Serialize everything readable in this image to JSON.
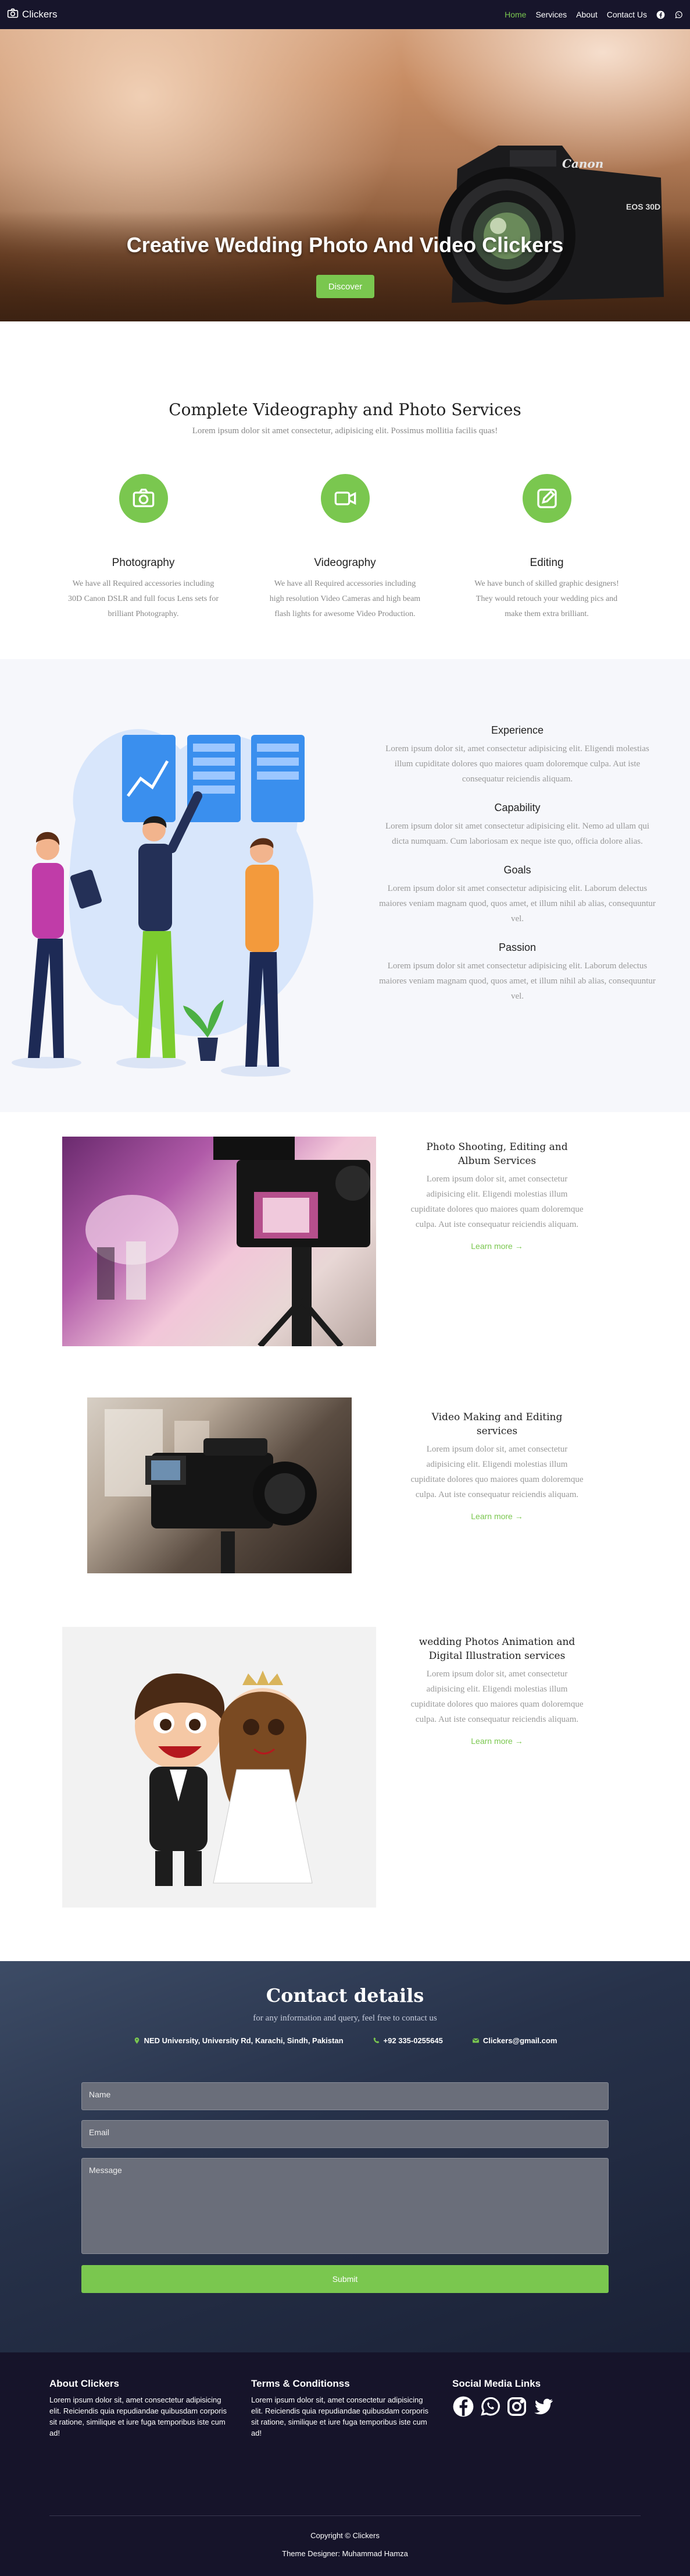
{
  "nav": {
    "brand": "Clickers",
    "links": [
      "Home",
      "Services",
      "About",
      "Contact Us"
    ],
    "accent": "#7ac74f",
    "background": "#17152b",
    "icons": [
      "camera-icon",
      "facebook-icon",
      "whatsapp-icon"
    ]
  },
  "hero": {
    "title": "Creative Wedding Photo And Video Clickers",
    "button": "Discover",
    "camera_brand": "Canon",
    "camera_model": "EOS 30D"
  },
  "services": {
    "title": "Complete Videography and Photo Services",
    "subtitle": "Lorem ipsum dolor sit amet consectetur, adipisicing elit. Possimus mollitia facilis quas!",
    "items": [
      {
        "title": "Photography",
        "text": "We have all Required accessories including 30D Canon DSLR and full focus Lens sets for brilliant Photography.",
        "icon": "camera-icon"
      },
      {
        "title": "Videography",
        "text": "We have all Required accessories including high resolution Video Cameras and high beam flash lights for awesome Video Production.",
        "icon": "video-camera-icon"
      },
      {
        "title": "Editing",
        "text": "We have bunch of skilled graphic designers! They would retouch your wedding pics and make them extra brilliant.",
        "icon": "edit-icon"
      }
    ]
  },
  "about": {
    "features": [
      {
        "title": "Experience",
        "text": "Lorem ipsum dolor sit, amet consectetur adipisicing elit. Eligendi molestias illum cupiditate dolores quo maiores quam doloremque culpa. Aut iste consequatur reiciendis aliquam."
      },
      {
        "title": "Capability",
        "text": "Lorem ipsum dolor sit amet consectetur adipisicing elit. Nemo ad ullam qui dicta numquam. Cum laboriosam ex neque iste quo, officia dolore alias."
      },
      {
        "title": "Goals",
        "text": "Lorem ipsum dolor sit amet consectetur adipisicing elit. Laborum delectus maiores veniam magnam quod, quos amet, et illum nihil ab alias, consequuntur vel."
      },
      {
        "title": "Passion",
        "text": "Lorem ipsum dolor sit amet consectetur adipisicing elit. Laborum delectus maiores veniam magnam quod, quos amet, et illum nihil ab alias, consequuntur vel."
      }
    ]
  },
  "portfolio": [
    {
      "title": "Photo Shooting, Editing and Album Services",
      "text": "Lorem ipsum dolor sit, amet consectetur adipisicing elit. Eligendi molestias illum cupiditate dolores quo maiores quam doloremque culpa. Aut iste consequatur reiciendis aliquam.",
      "link": "Learn more",
      "arrow": "→"
    },
    {
      "title": "Video Making and Editing services",
      "text": "Lorem ipsum dolor sit, amet consectetur adipisicing elit. Eligendi molestias illum cupiditate dolores quo maiores quam doloremque culpa. Aut iste consequatur reiciendis aliquam.",
      "link": "Learn more",
      "arrow": "→"
    },
    {
      "title": "wedding Photos Animation and Digital Illustration services",
      "text": "Lorem ipsum dolor sit, amet consectetur adipisicing elit. Eligendi molestias illum cupiditate dolores quo maiores quam doloremque culpa. Aut iste consequatur reiciendis aliquam.",
      "link": "Learn more",
      "arrow": "→"
    }
  ],
  "contact": {
    "title": "Contact details",
    "subtitle": "for any information and query, feel free to contact us",
    "address": "NED University, University Rd, Karachi, Sindh, Pakistan",
    "phone": "+92 335-0255645",
    "email": "Clickers@gmail.com",
    "placeholders": {
      "name": "Name",
      "email": "Email",
      "message": "Message"
    },
    "submit": "Submit"
  },
  "footer": {
    "about_title": "About Clickers",
    "about_text": "Lorem ipsum dolor sit, amet consectetur adipisicing elit. Reiciendis quia repudiandae quibusdam corporis sit ratione, similique et iure fuga temporibus iste cum ad!",
    "terms_title": "Terms & Conditionss",
    "terms_text": "Lorem ipsum dolor sit, amet consectetur adipisicing elit. Reiciendis quia repudiandae quibusdam corporis sit ratione, similique et iure fuga temporibus iste cum ad!",
    "social_title": "Social Media Links",
    "social_icons": [
      "facebook-icon",
      "whatsapp-icon",
      "instagram-icon",
      "twitter-icon"
    ],
    "copyright": "Copyright © Clickers",
    "designer": "Theme Designer: Muhammad Hamza"
  }
}
